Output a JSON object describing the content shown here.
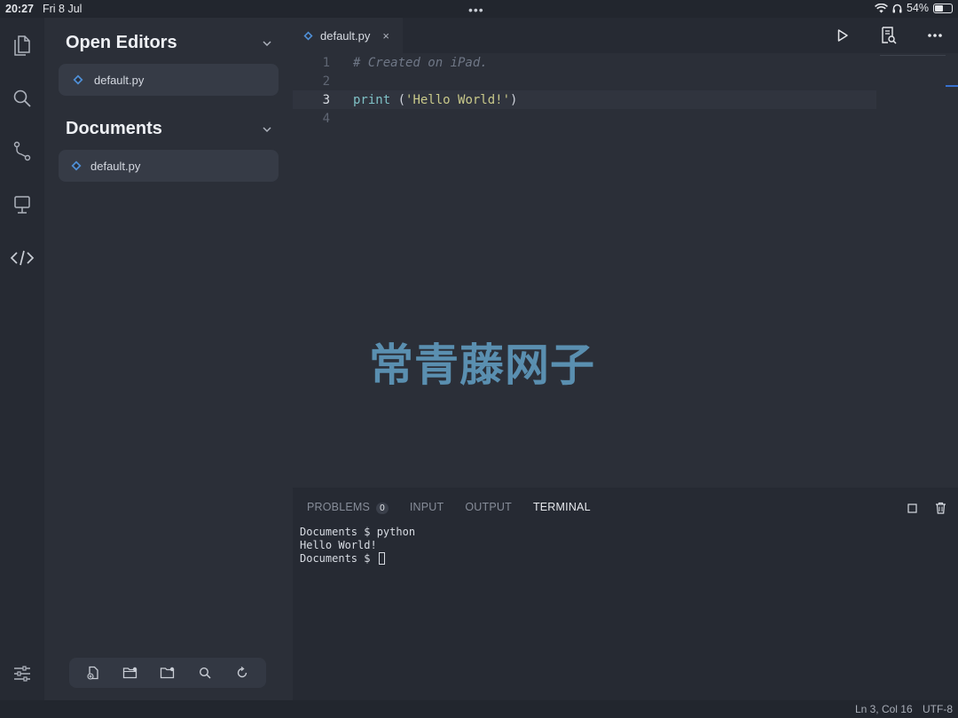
{
  "status_bar": {
    "time": "20:27",
    "date": "Fri 8 Jul",
    "dots": "•••",
    "battery": "54%",
    "battery_level": 0.54
  },
  "activity_bar": {
    "icons": [
      "files-icon",
      "search-icon",
      "source-control-icon",
      "remote-icon",
      "code-icon",
      "settings-sliders-icon"
    ]
  },
  "sidebar": {
    "open_editors": {
      "title": "Open Editors",
      "files": [
        "default.py"
      ]
    },
    "documents": {
      "title": "Documents",
      "files": [
        "default.py"
      ]
    },
    "bottom_tools": [
      "new-file-icon",
      "new-folder-icon",
      "open-folder-icon",
      "search-icon",
      "refresh-icon"
    ]
  },
  "editor": {
    "tab": {
      "label": "default.py",
      "close": "×"
    },
    "toolbar": [
      "run-icon",
      "preview-icon",
      "more-icon"
    ],
    "lines": [
      {
        "number": "1",
        "comment": "# Created on iPad."
      },
      {
        "number": "2"
      },
      {
        "number": "3",
        "keyword": "print",
        "open": " (",
        "string": "'Hello World!'",
        "close": ")"
      },
      {
        "number": "4"
      }
    ]
  },
  "watermark": "常青藤网子",
  "panel": {
    "tabs": [
      {
        "label": "PROBLEMS",
        "badge": "0"
      },
      {
        "label": "INPUT"
      },
      {
        "label": "OUTPUT"
      },
      {
        "label": "TERMINAL"
      }
    ],
    "active_tab": "TERMINAL",
    "terminal_lines": [
      "Documents $ python",
      "Hello World!",
      "Documents $ "
    ]
  },
  "footer": {
    "position": "Ln 3, Col 16",
    "encoding": "UTF-8"
  },
  "colors": {
    "accent": "#3b82f6",
    "python": "#4f8fd6",
    "string": "#c9c98a",
    "keyword": "#7fc1c6"
  }
}
